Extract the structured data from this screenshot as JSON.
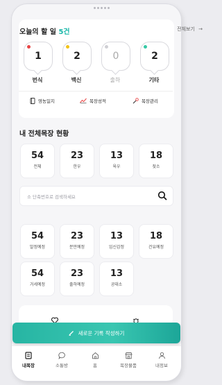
{
  "todo": {
    "title": "오늘의 할 일",
    "count": "5건",
    "view_all": "전체보기"
  },
  "todo_items": [
    {
      "value": "1",
      "label": "번식",
      "dot": "#e84545"
    },
    {
      "value": "2",
      "label": "백신",
      "dot": "#f2c318"
    },
    {
      "value": "0",
      "label": "출하",
      "dot": "#cfcfd4"
    },
    {
      "value": "2",
      "label": "기타",
      "dot": "#36c9a6"
    }
  ],
  "quick": {
    "log": "영농일지",
    "growth": "목장성적",
    "manage": "목장관리"
  },
  "herd": {
    "title": "내 전체목장 현황",
    "stats": [
      {
        "num": "54",
        "label": "전체"
      },
      {
        "num": "23",
        "label": "한우"
      },
      {
        "num": "13",
        "label": "육우"
      },
      {
        "num": "18",
        "label": "젖소"
      }
    ]
  },
  "search": {
    "placeholder": "소 단축번호로 검색하세요"
  },
  "status": [
    {
      "num": "54",
      "label": "발정예정"
    },
    {
      "num": "23",
      "label": "분만예정"
    },
    {
      "num": "13",
      "label": "임신감정"
    },
    {
      "num": "18",
      "label": "건유예정"
    },
    {
      "num": "54",
      "label": "거세예정"
    },
    {
      "num": "23",
      "label": "출하예정"
    },
    {
      "num": "13",
      "label": "공태소"
    }
  ],
  "cta": {
    "label": "새로운 기록 작성하기"
  },
  "tabs": [
    {
      "label": "내목장",
      "icon": "barn-list-icon"
    },
    {
      "label": "소통방",
      "icon": "chat-icon"
    },
    {
      "label": "홈",
      "icon": "home-icon"
    },
    {
      "label": "목장물품",
      "icon": "store-icon"
    },
    {
      "label": "내정보",
      "icon": "person-icon"
    }
  ],
  "colors": {
    "accent": "#17b7a8",
    "cta_start": "#27b5a3",
    "cta_end": "#1ca698"
  }
}
